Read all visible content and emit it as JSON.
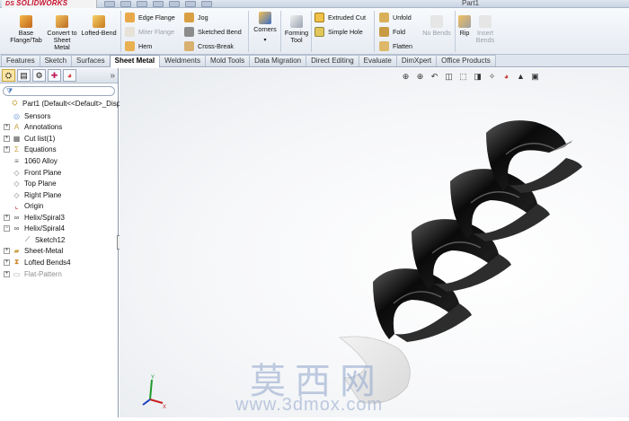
{
  "app": {
    "logo_text": "SOLIDWORKS",
    "logo_prefix": "DS",
    "document_title": "Part1"
  },
  "ribbon": {
    "base_flange": "Base Flange/Tab",
    "convert": "Convert to Sheet Metal",
    "lofted_bend": "Lofted-Bend",
    "edge_flange": "Edge Flange",
    "miter_flange": "Miter Flange",
    "hem": "Hem",
    "jog": "Jog",
    "sketched_bend": "Sketched Bend",
    "cross_break": "Cross-Break",
    "corners": "Corners",
    "forming_tool": "Forming Tool",
    "extruded_cut": "Extruded Cut",
    "simple_hole": "Simple Hole",
    "unfold": "Unfold",
    "fold": "Fold",
    "flatten": "Flatten",
    "no_bends": "No Bends",
    "rip": "Rip",
    "insert_bends": "Insert Bends"
  },
  "tabs": [
    "Features",
    "Sketch",
    "Surfaces",
    "Sheet Metal",
    "Weldments",
    "Mold Tools",
    "Data Migration",
    "Direct Editing",
    "Evaluate",
    "DimXpert",
    "Office Products"
  ],
  "active_tab": "Sheet Metal",
  "tree": {
    "part": "Part1  (Default<<Default>_Disp",
    "sensors": "Sensors",
    "annotations": "Annotations",
    "cut_list": "Cut list(1)",
    "equations": "Equations",
    "material": "1060 Alloy",
    "front_plane": "Front Plane",
    "top_plane": "Top Plane",
    "right_plane": "Right Plane",
    "origin": "Origin",
    "helix3": "Helix/Spiral3",
    "helix4": "Helix/Spiral4",
    "sketch12": "Sketch12",
    "sheet_metal": "Sheet-Metal",
    "lofted_bends": "Lofted Bends4",
    "flat_pattern": "Flat-Pattern"
  },
  "watermark": {
    "cn": "莫西网",
    "url": "www.3dmox.com"
  },
  "triad": {
    "y": "Y",
    "x": "X"
  },
  "colors": {
    "accent": "#c8102e",
    "ribbon_bg": "#eef2f7",
    "active_tab": "#ffffff",
    "model": "#111111"
  }
}
